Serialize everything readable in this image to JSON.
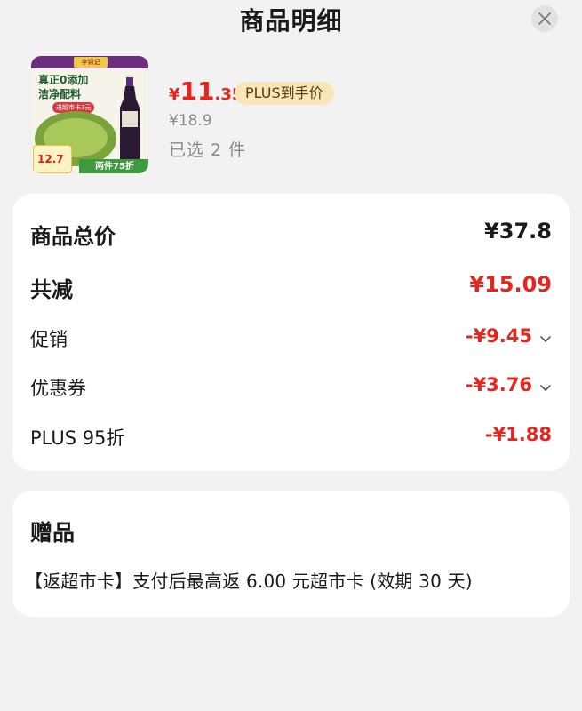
{
  "header": {
    "title": "商品明细"
  },
  "icons": {
    "close": "close-icon",
    "chevron": "chevron-down-icon"
  },
  "product": {
    "image_texts": {
      "brand": "李锦记",
      "line1": "真正0添加",
      "line2": "洁净配料",
      "pill": "进超市卡3元",
      "price": "12.7",
      "bar": "两件75折"
    },
    "price_currency": "¥",
    "price_int": "11",
    "price_dec": ".35",
    "plus_badge": "PLUS到手价",
    "original_price": "¥18.9",
    "quantity": "已选 2 件"
  },
  "summary": {
    "total_label": "商品总价",
    "total_value": "¥37.8",
    "discount_label": "共减",
    "discount_value": "¥15.09",
    "promo_label": "促销",
    "promo_value": "-¥9.45",
    "coupon_label": "优惠券",
    "coupon_value": "-¥3.76",
    "plus_label": "PLUS 95折",
    "plus_value": "-¥1.88"
  },
  "gift": {
    "title": "赠品",
    "text": "【返超市卡】支付后最高返 6.00 元超市卡 (效期 30 天)"
  },
  "colors": {
    "accent_red": "#e4261f",
    "background": "#f2f2f2",
    "card": "#ffffff",
    "plus_badge_bg": "#f8e6b9",
    "plus_badge_text": "#5a3b12"
  }
}
